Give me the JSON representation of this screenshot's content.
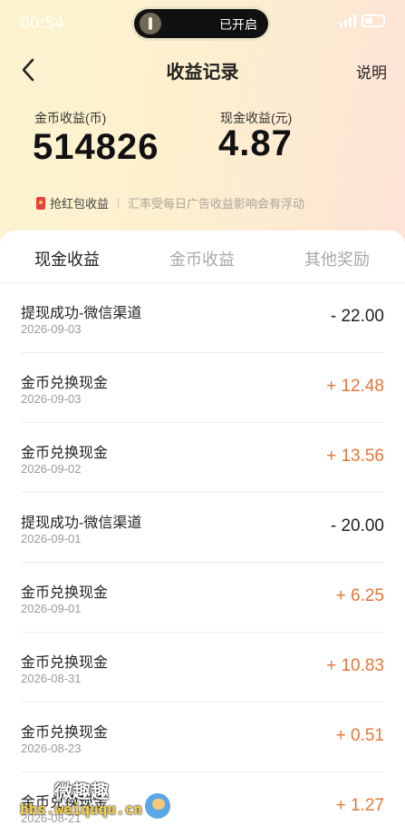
{
  "status_bar": {
    "time": "00:54",
    "island_text": "已开启"
  },
  "nav": {
    "title": "收益记录",
    "help": "说明"
  },
  "summary": {
    "coin_label": "金币收益(币)",
    "coin_value": "514826",
    "cash_label": "现金收益(元)",
    "cash_value": "4.87"
  },
  "notice": {
    "button": "抢红包收益",
    "text": "汇率受每日广告收益影响会有浮动"
  },
  "tabs": [
    {
      "label": "现金收益",
      "active": true
    },
    {
      "label": "金币收益",
      "active": false
    },
    {
      "label": "其他奖励",
      "active": false
    }
  ],
  "records": [
    {
      "title": "提现成功-微信渠道",
      "date": "2026-09-03",
      "amount": "- 22.00",
      "sign": "neg"
    },
    {
      "title": "金币兑换现金",
      "date": "2026-09-03",
      "amount": "+ 12.48",
      "sign": "pos"
    },
    {
      "title": "金币兑换现金",
      "date": "2026-09-02",
      "amount": "+ 13.56",
      "sign": "pos"
    },
    {
      "title": "提现成功-微信渠道",
      "date": "2026-09-01",
      "amount": "- 20.00",
      "sign": "neg"
    },
    {
      "title": "金币兑换现金",
      "date": "2026-09-01",
      "amount": "+ 6.25",
      "sign": "pos"
    },
    {
      "title": "金币兑换现金",
      "date": "2026-08-31",
      "amount": "+ 10.83",
      "sign": "pos"
    },
    {
      "title": "金币兑换现金",
      "date": "2026-08-23",
      "amount": "+ 0.51",
      "sign": "pos"
    },
    {
      "title": "金币兑换现金",
      "date": "2026-08-21",
      "amount": "+ 1.27",
      "sign": "pos"
    }
  ],
  "watermark": {
    "top": "微趣趣",
    "bottom": "bbs.weiququ.cn"
  },
  "colors": {
    "positive": "#e5763a",
    "negative": "#222222",
    "header_gradient_start": "#fdf3cf",
    "header_gradient_end": "#fde3d6"
  }
}
